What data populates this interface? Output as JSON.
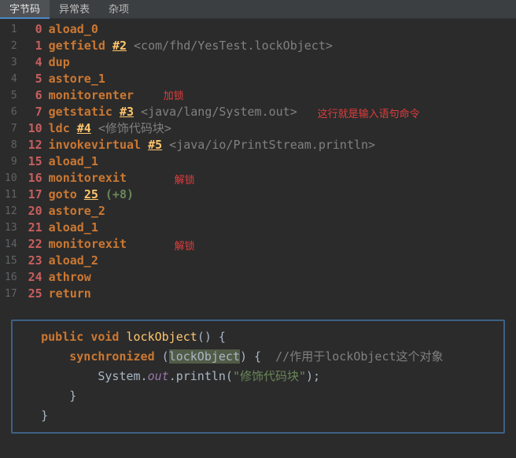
{
  "tabs": {
    "bytecode": "字节码",
    "exceptions": "异常表",
    "misc": "杂项"
  },
  "bytecode": {
    "rows": [
      {
        "g": "1",
        "o": "0",
        "ins": "aload_0"
      },
      {
        "g": "2",
        "o": "1",
        "ins": "getfield",
        "ref": "#2",
        "trail": " <com/fhd/YesTest.lockObject>"
      },
      {
        "g": "3",
        "o": "4",
        "ins": "dup"
      },
      {
        "g": "4",
        "o": "5",
        "ins": "astore_1"
      },
      {
        "g": "5",
        "o": "6",
        "ins": "monitorenter"
      },
      {
        "g": "6",
        "o": "7",
        "ins": "getstatic",
        "ref": "#3",
        "trail": " <java/lang/System.out>"
      },
      {
        "g": "7",
        "o": "10",
        "ins": "ldc",
        "ref": "#4",
        "trail": " <修饰代码块>"
      },
      {
        "g": "8",
        "o": "12",
        "ins": "invokevirtual",
        "ref": "#5",
        "trail": " <java/io/PrintStream.println>"
      },
      {
        "g": "9",
        "o": "15",
        "ins": "aload_1"
      },
      {
        "g": "10",
        "o": "16",
        "ins": "monitorexit"
      },
      {
        "g": "11",
        "o": "17",
        "ins": "goto",
        "jump": "25",
        "rel": " (+8)"
      },
      {
        "g": "12",
        "o": "20",
        "ins": "astore_2"
      },
      {
        "g": "13",
        "o": "21",
        "ins": "aload_1"
      },
      {
        "g": "14",
        "o": "22",
        "ins": "monitorexit"
      },
      {
        "g": "15",
        "o": "23",
        "ins": "aload_2"
      },
      {
        "g": "16",
        "o": "24",
        "ins": "athrow"
      },
      {
        "g": "17",
        "o": "25",
        "ins": "return"
      }
    ]
  },
  "annotations": {
    "lock": "加锁",
    "inputCmd": "这行就是输入语句命令",
    "unlock1": "解锁",
    "unlock2": "解锁"
  },
  "source": {
    "kw_public": "public",
    "kw_void": "void",
    "method": "lockObject",
    "parens_open": "() {",
    "kw_sync": "synchronized",
    "open_sync": " (",
    "obj": "lockObject",
    "close_sync_open_block": ") {  ",
    "comment": "//作用于lockObject这个对象",
    "sys": "System.",
    "out": "out",
    "println_call": ".println(",
    "string": "\"修饰代码块\"",
    "println_close": ");",
    "brace_close_inner": "}",
    "brace_close_outer": "}"
  }
}
